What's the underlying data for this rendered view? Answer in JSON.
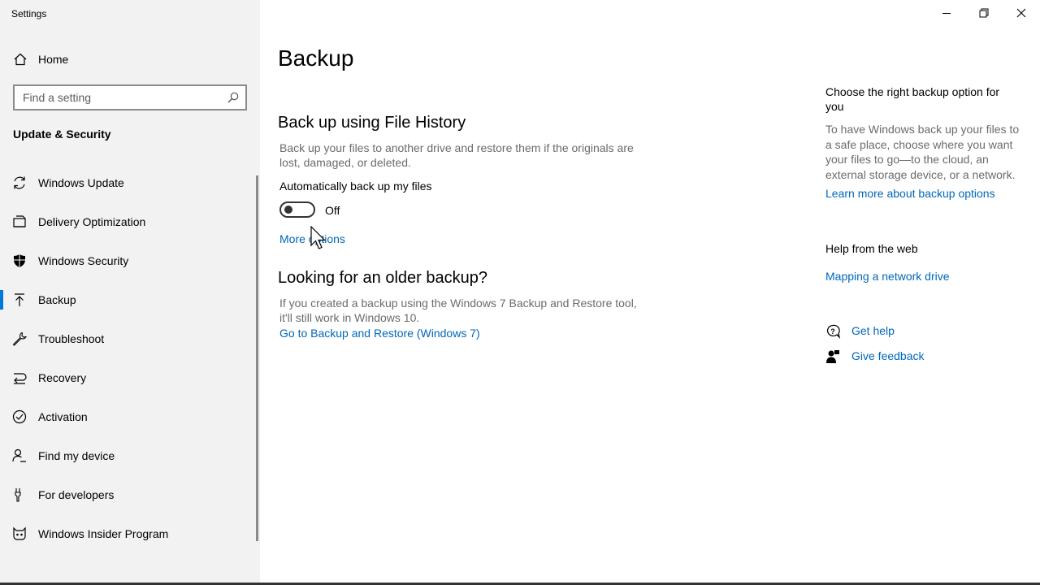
{
  "window": {
    "title": "Settings"
  },
  "sidebar": {
    "home_label": "Home",
    "search_placeholder": "Find a setting",
    "section_title": "Update & Security",
    "items": [
      {
        "label": "Windows Update",
        "icon": "sync-icon"
      },
      {
        "label": "Delivery Optimization",
        "icon": "delivery-optimization-icon"
      },
      {
        "label": "Windows Security",
        "icon": "shield-icon"
      },
      {
        "label": "Backup",
        "icon": "backup-arrow-icon",
        "active": true
      },
      {
        "label": "Troubleshoot",
        "icon": "wrench-icon"
      },
      {
        "label": "Recovery",
        "icon": "recovery-icon"
      },
      {
        "label": "Activation",
        "icon": "check-circle-icon"
      },
      {
        "label": "Find my device",
        "icon": "person-location-icon"
      },
      {
        "label": "For developers",
        "icon": "developer-tools-icon"
      },
      {
        "label": "Windows Insider Program",
        "icon": "insider-cat-icon"
      }
    ]
  },
  "main": {
    "title": "Backup",
    "file_history": {
      "heading": "Back up using File History",
      "description": "Back up your files to another drive and restore them if the originals are lost, damaged, or deleted.",
      "toggle_label": "Automatically back up my files",
      "toggle_state": "Off",
      "more_options": "More options"
    },
    "older_backup": {
      "heading": "Looking for an older backup?",
      "description": "If you created a backup using the Windows 7 Backup and Restore tool, it'll still work in Windows 10.",
      "link": "Go to Backup and Restore (Windows 7)"
    }
  },
  "right": {
    "choose_heading": "Choose the right backup option for you",
    "choose_desc": "To have Windows back up your files to a safe place, choose where you want your files to go—to the cloud, an external storage device, or a network.",
    "learn_more": "Learn more about backup options",
    "help_heading": "Help from the web",
    "help_link": "Mapping a network drive",
    "get_help": "Get help",
    "give_feedback": "Give feedback"
  },
  "colors": {
    "accent": "#0078d7",
    "link": "#0067b8",
    "sidebar_bg": "#f2f2f2"
  }
}
